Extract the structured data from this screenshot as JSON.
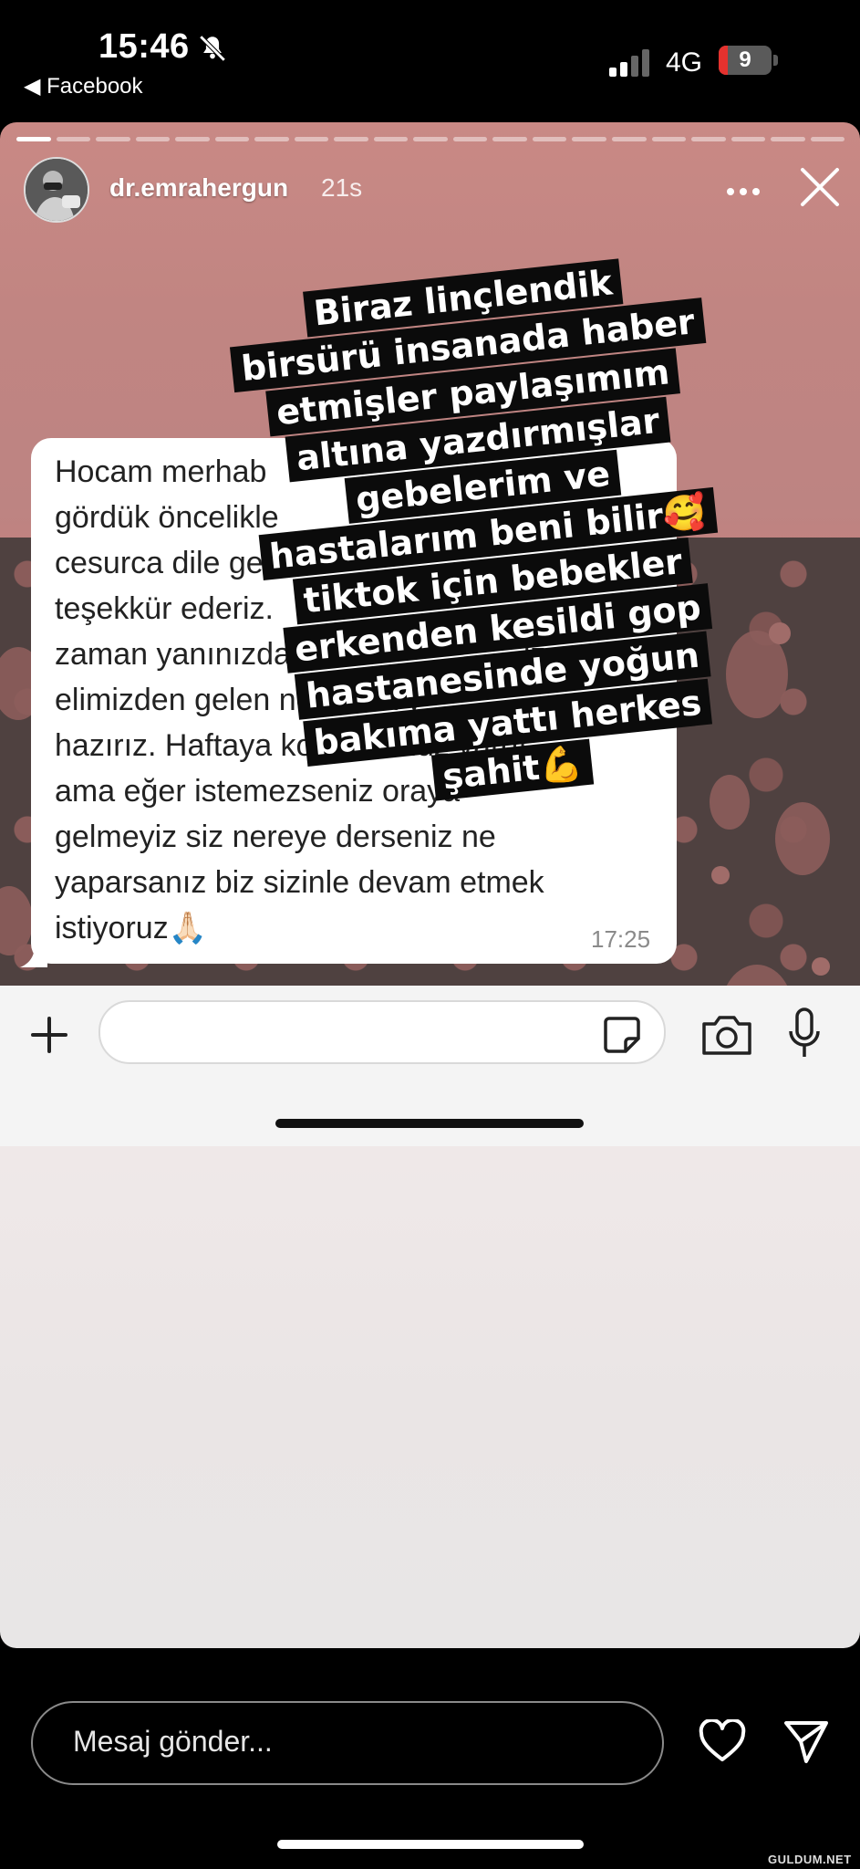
{
  "status_bar": {
    "time": "15:46",
    "back_app": "◀ Facebook",
    "network": "4G",
    "battery": "9",
    "bell_icon": "bell-muted-icon"
  },
  "story": {
    "username": "dr.emrahergun",
    "age": "21s",
    "progress": {
      "segments": 21,
      "completed": 1
    }
  },
  "chat": {
    "message": "Hocam merhab                              \ngördük öncelikle\ncesurca dile get\nteşekkür ederiz.\nzaman yanınızda                           iz\nelimizden gelen ne varsa y\nhazırız. Haftaya kontrolümüz vardı\nama eğer istemezseniz oraya\ngelmeyiz siz nereye derseniz ne\nyaparsanız biz sizinle devam etmek\nistiyoruz🙏🏻",
    "time": "17:25"
  },
  "caption": {
    "lines": [
      "Biraz linçlendik",
      "birsürü insanada haber",
      "etmişler paylaşımım",
      "altına yazdırmışlar",
      "gebelerim ve",
      "hastalarım beni bilir🥰",
      "tiktok için bebekler",
      "erkenden kesildi gop",
      "hastanesinde yoğun",
      "bakıma yattı herkes",
      "şahit💪"
    ]
  },
  "reply": {
    "placeholder": "Mesaj gönder..."
  },
  "watermark": "GULDUM.NET",
  "colors": {
    "story_top": "#c98985",
    "wallpaper": "#4f4140",
    "caption_bg": "#0b0b0b"
  }
}
